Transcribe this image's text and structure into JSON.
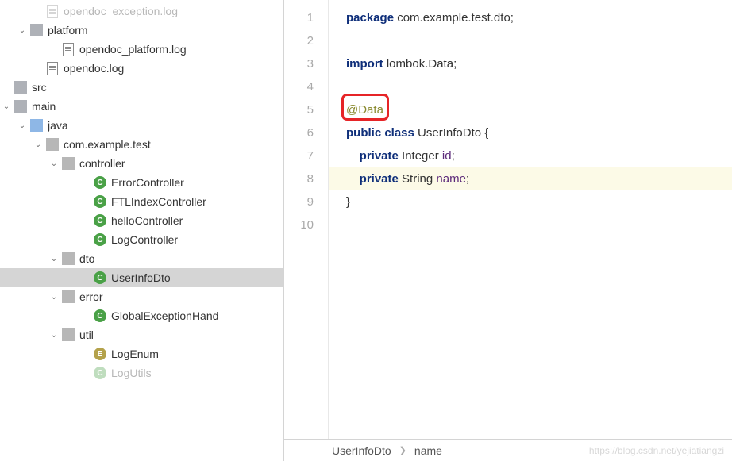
{
  "tree": {
    "rows": [
      {
        "indent": 2,
        "chev": "",
        "icon": "file",
        "label": "opendoc_exception.log",
        "faded": true
      },
      {
        "indent": 1,
        "chev": "v",
        "icon": "folder",
        "label": "platform"
      },
      {
        "indent": 3,
        "chev": "",
        "icon": "file",
        "label": "opendoc_platform.log"
      },
      {
        "indent": 2,
        "chev": "",
        "icon": "file",
        "label": "opendoc.log"
      },
      {
        "indent": 0,
        "chev": "",
        "icon": "folder",
        "label": "src"
      },
      {
        "indent": 0,
        "chev": "v",
        "icon": "folder",
        "label": "main"
      },
      {
        "indent": 1,
        "chev": "v",
        "icon": "folder-open",
        "label": "java"
      },
      {
        "indent": 2,
        "chev": "v",
        "icon": "folder-pkg",
        "label": "com.example.test"
      },
      {
        "indent": 3,
        "chev": "v",
        "icon": "folder-pkg",
        "label": "controller"
      },
      {
        "indent": 5,
        "chev": "",
        "icon": "class-c",
        "label": "ErrorController"
      },
      {
        "indent": 5,
        "chev": "",
        "icon": "class-c",
        "label": "FTLIndexController"
      },
      {
        "indent": 5,
        "chev": "",
        "icon": "class-c",
        "label": "helloController"
      },
      {
        "indent": 5,
        "chev": "",
        "icon": "class-c",
        "label": "LogController"
      },
      {
        "indent": 3,
        "chev": "v",
        "icon": "folder-pkg",
        "label": "dto"
      },
      {
        "indent": 5,
        "chev": "",
        "icon": "class-c",
        "label": "UserInfoDto",
        "selected": true
      },
      {
        "indent": 3,
        "chev": "v",
        "icon": "folder-pkg",
        "label": "error"
      },
      {
        "indent": 5,
        "chev": "",
        "icon": "class-c",
        "label": "GlobalExceptionHand"
      },
      {
        "indent": 3,
        "chev": "v",
        "icon": "folder-pkg",
        "label": "util"
      },
      {
        "indent": 5,
        "chev": "",
        "icon": "class-e",
        "label": "LogEnum"
      },
      {
        "indent": 5,
        "chev": "",
        "icon": "class-c",
        "label": "LogUtils",
        "faded": true
      }
    ]
  },
  "editor": {
    "lines": [
      {
        "n": 1,
        "tokens": [
          {
            "t": "package ",
            "c": "kw"
          },
          {
            "t": "com.example.test.dto;",
            "c": ""
          }
        ]
      },
      {
        "n": 2,
        "tokens": []
      },
      {
        "n": 3,
        "tokens": [
          {
            "t": "import ",
            "c": "kw"
          },
          {
            "t": "lombok.",
            "c": ""
          },
          {
            "t": "Data",
            "c": ""
          },
          {
            "t": ";",
            "c": ""
          }
        ]
      },
      {
        "n": 4,
        "tokens": []
      },
      {
        "n": 5,
        "tokens": [
          {
            "t": "@Data",
            "c": "ann"
          }
        ],
        "box": true
      },
      {
        "n": 6,
        "tokens": [
          {
            "t": "public class ",
            "c": "kw"
          },
          {
            "t": "UserInfoDto {",
            "c": ""
          }
        ]
      },
      {
        "n": 7,
        "tokens": [
          {
            "t": "    ",
            "c": ""
          },
          {
            "t": "private ",
            "c": "kw"
          },
          {
            "t": "Integer ",
            "c": ""
          },
          {
            "t": "id",
            "c": "name"
          },
          {
            "t": ";",
            "c": ""
          }
        ]
      },
      {
        "n": 8,
        "hl": true,
        "tokens": [
          {
            "t": "    ",
            "c": ""
          },
          {
            "t": "private ",
            "c": "kw"
          },
          {
            "t": "String ",
            "c": ""
          },
          {
            "t": "name",
            "c": "name"
          },
          {
            "t": ";",
            "c": ""
          }
        ]
      },
      {
        "n": 9,
        "tokens": [
          {
            "t": "}",
            "c": ""
          }
        ]
      },
      {
        "n": 10,
        "tokens": []
      }
    ]
  },
  "breadcrumb": {
    "a": "UserInfoDto",
    "b": "name"
  },
  "watermark": "https://blog.csdn.net/yejiatiangzi"
}
